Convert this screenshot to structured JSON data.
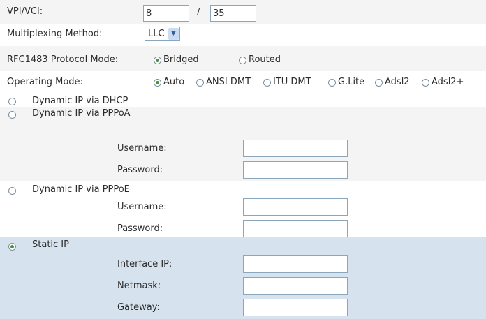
{
  "colors": {
    "row_bg": "#f4f4f4",
    "selected_bg": "#d6e3ee",
    "input_border": "#8aa6bd"
  },
  "atm": {
    "vpivci_label": "VPI/VCI:",
    "vpi_value": "8",
    "separator": "/",
    "vci_value": "35",
    "mux_label": "Multiplexing Method:",
    "mux_value": "LLC",
    "rfc_label": "RFC1483 Protocol Mode:",
    "rfc_options": [
      "Bridged",
      "Routed"
    ],
    "rfc_selected": "Bridged",
    "op_label": "Operating Mode:",
    "op_options": [
      "Auto",
      "ANSI DMT",
      "ITU DMT",
      "G.Lite",
      "Adsl2",
      "Adsl2+"
    ],
    "op_selected": "Auto"
  },
  "wan": {
    "dhcp_label": "Dynamic IP via DHCP",
    "pppoa": {
      "label": "Dynamic IP via PPPoA",
      "username_label": "Username:",
      "password_label": "Password:",
      "username_value": "",
      "password_value": ""
    },
    "pppoe": {
      "label": "Dynamic IP via PPPoE",
      "username_label": "Username:",
      "password_label": "Password:",
      "username_value": "",
      "password_value": ""
    },
    "static": {
      "label": "Static IP",
      "ip_label": "Interface IP:",
      "netmask_label": "Netmask:",
      "gateway_label": "Gateway:",
      "ip_value": "",
      "netmask_value": "",
      "gateway_value": ""
    },
    "selected": "Static IP"
  }
}
